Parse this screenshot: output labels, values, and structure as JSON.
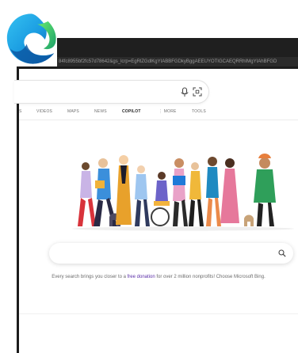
{
  "address_bar": {
    "url_fragment": "84fc8955bf2fc57d78642&gs_lcrp=EgRlZGdlKgYIABBFGDkyBggAEEUYOTIGCAEQRRhIMgYIAhBFGD"
  },
  "search_top": {
    "mic_icon": "microphone-icon",
    "visual_search_icon": "visual-search-icon"
  },
  "tabs": [
    {
      "label": "S",
      "active": false
    },
    {
      "label": "VIDEOS",
      "active": false
    },
    {
      "label": "MAPS",
      "active": false
    },
    {
      "label": "NEWS",
      "active": false
    },
    {
      "label": "COPILOT",
      "active": true
    },
    {
      "label": "⋮ MORE",
      "active": false
    },
    {
      "label": "TOOLS",
      "active": false
    }
  ],
  "main_search": {
    "icon": "search-icon"
  },
  "promo": {
    "before": "Every search brings you closer to a ",
    "link": "free donation",
    "after": " for over 2 million nonprofits! Choose Microsoft Bing."
  },
  "colors": {
    "frame_dark": "#1f1f1f",
    "link_purple": "#5a2ea8",
    "edge_blue": "#0c59a4",
    "edge_green": "#36c16b"
  }
}
